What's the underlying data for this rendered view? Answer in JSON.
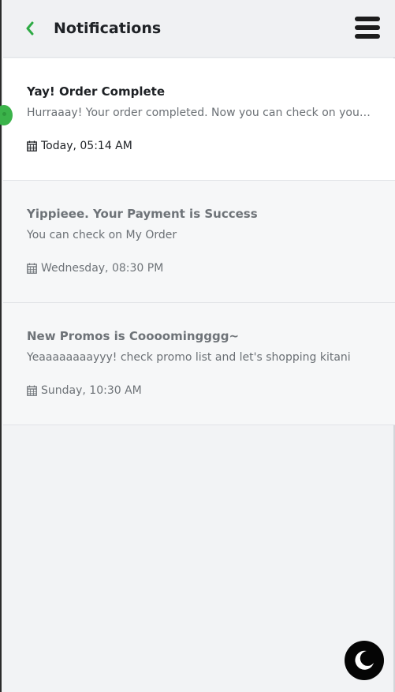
{
  "header": {
    "title": "Notifications",
    "back_icon": "chevron-left-icon",
    "menu_icon": "hamburger-menu-icon"
  },
  "colors": {
    "accent": "#3bb34a",
    "unread_bg": "#ffffff",
    "read_bg": "#f6f7f8"
  },
  "notifications": [
    {
      "title": "Yay! Order Complete",
      "body": "Hurraaay! Your order completed. Now you can check on your order history",
      "date": "Today, 05:14 AM",
      "unread": true
    },
    {
      "title": "Yippieee. Your Payment is Success",
      "body": "You can check on My Order",
      "date": "Wednesday, 08:30 PM",
      "unread": false
    },
    {
      "title": "New Promos is Coooomingggg~",
      "body": "Yeaaaaaaaayyy! check promo list and let's shopping kitani",
      "date": "Sunday, 10:30 AM",
      "unread": false
    }
  ],
  "fab": {
    "icon": "moon-icon"
  }
}
